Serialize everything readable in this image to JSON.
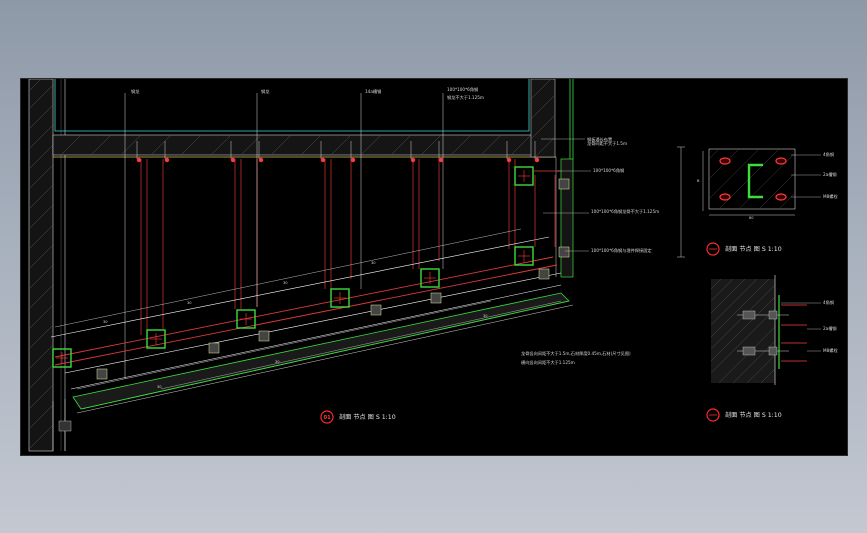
{
  "drawing": {
    "annotations_top": [
      "钢龙",
      "钢龙",
      "14a槽钢",
      "100*100*6角钢",
      "钢龙不大于1.125m",
      "钢板通长布置",
      "龙骨间距不大于1.5m"
    ],
    "annotations_right": [
      "100*100*6角钢",
      "100*100*6角钢龙骨不大于1.125m",
      "100*100*6角钢与埋件焊接固定"
    ],
    "note_lines": [
      "龙骨竖向间距不大于1.5m,石材厚度0.45m,石材(尺寸见图)",
      "横向竖向间距不大于1.125m"
    ],
    "dims_upper": [
      "30",
      "30",
      "30",
      "30"
    ],
    "dims_lower": [
      "30",
      "30",
      "30"
    ],
    "dim_b": "B",
    "dim_w": "80",
    "titles": [
      {
        "num": "01",
        "text": "剖面 节点 图 S 1:10"
      },
      {
        "num": "",
        "text": "剖面 节点 图 S 1:10"
      },
      {
        "num": "",
        "text": "剖面 节点 图 S 1:10"
      }
    ],
    "detail_labels": [
      "4角钢",
      "2a槽钢",
      "M8螺栓"
    ],
    "detail_labels_2": [
      "4角钢",
      "2a槽钢",
      "M8螺栓"
    ]
  }
}
